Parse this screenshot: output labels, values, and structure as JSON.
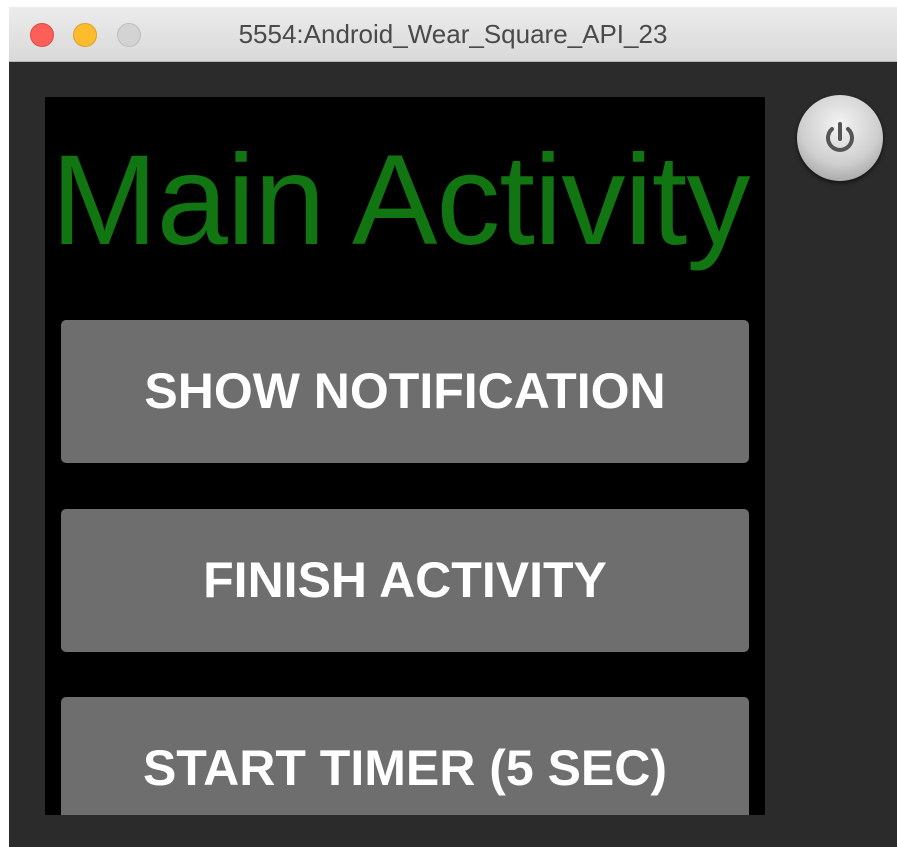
{
  "window": {
    "title": "5554:Android_Wear_Square_API_23"
  },
  "app": {
    "title": "Main Activity",
    "buttons": [
      {
        "label": "SHOW NOTIFICATION"
      },
      {
        "label": "FINISH ACTIVITY"
      },
      {
        "label": "START TIMER (5 SEC)"
      }
    ]
  },
  "icons": {
    "power": "power-icon"
  },
  "colors": {
    "title_green": "#117611",
    "button_gray": "#6e6e6e",
    "close": "#fc5f57",
    "minimize": "#fdbc2e",
    "zoom": "#d3d3d3"
  }
}
